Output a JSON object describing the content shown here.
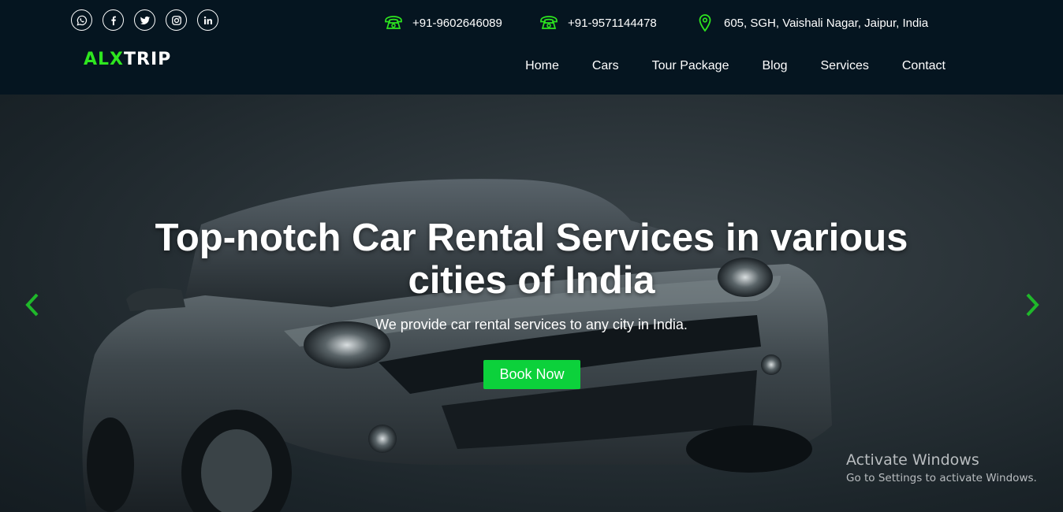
{
  "socials": [
    {
      "icon": "whatsapp-icon"
    },
    {
      "icon": "facebook-icon"
    },
    {
      "icon": "twitter-icon"
    },
    {
      "icon": "instagram-icon"
    },
    {
      "icon": "linkedin-icon"
    }
  ],
  "contact": {
    "phone1": "+91-9602646089",
    "phone2": "+91-9571144478",
    "address": "605, SGH, Vaishali Nagar, Jaipur, India"
  },
  "logo": {
    "part1": "ALX",
    "part2": "TRIP"
  },
  "nav": [
    "Home",
    "Cars",
    "Tour Package",
    "Blog",
    "Services",
    "Contact"
  ],
  "hero": {
    "title_line1": "Top-notch Car Rental Services in various",
    "title_line2": "cities of India",
    "subtitle": "We provide car rental services to any city in India.",
    "button": "Book Now"
  },
  "watermark": {
    "line1": "Activate Windows",
    "line2": "Go to Settings to activate Windows."
  },
  "colors": {
    "accent": "#2ee61f",
    "button": "#0cd13b",
    "header_bg": "#051520"
  }
}
